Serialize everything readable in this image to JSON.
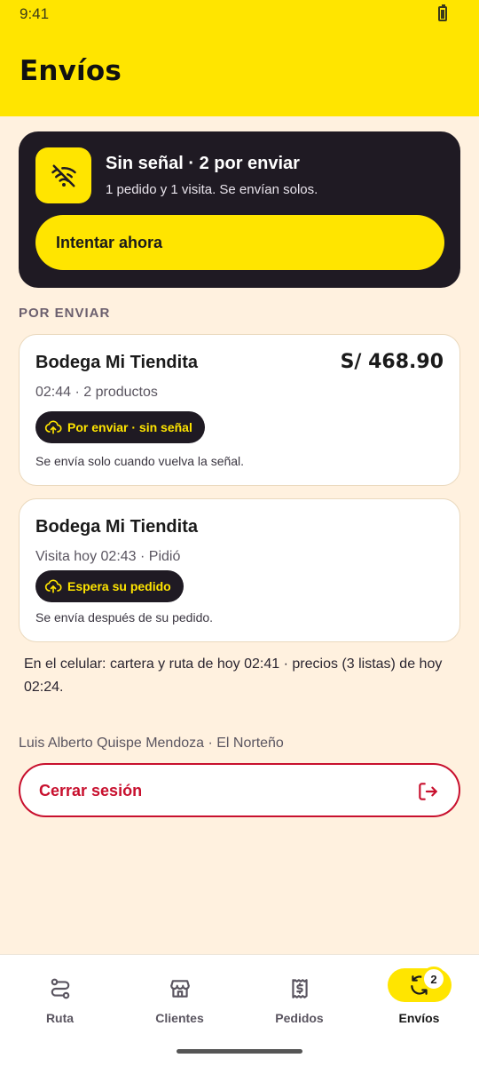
{
  "status_bar": {
    "time": "9:41"
  },
  "header": {
    "title": "Envíos"
  },
  "banner": {
    "icon": "wifi-off-icon",
    "title": "Sin señal · 2 por enviar",
    "subtitle": "1 pedido y 1 visita. Se envían solos.",
    "retry_label": "Intentar ahora"
  },
  "pending": {
    "section_label": "POR ENVIAR",
    "items": [
      {
        "name": "Bodega Mi Tiendita",
        "amount": "S/ 468.90",
        "meta": "02:44 · 2 productos",
        "chip": "Por enviar · sin señal",
        "note": "Se envía solo cuando vuelva la señal."
      },
      {
        "name": "Bodega Mi Tiendita",
        "meta": "Visita hoy 02:43 · Pidió",
        "chip": "Espera su pedido",
        "note": "Se envía después de su pedido."
      }
    ]
  },
  "sync_info": "En el celular: cartera y ruta de hoy 02:41 · precios (3 listas) de hoy 02:24.",
  "user": {
    "line": "Luis Alberto Quispe Mendoza · El Norteño"
  },
  "logout": {
    "label": "Cerrar sesión"
  },
  "nav": {
    "items": [
      {
        "label": "Ruta",
        "icon": "route-icon"
      },
      {
        "label": "Clientes",
        "icon": "store-icon"
      },
      {
        "label": "Pedidos",
        "icon": "receipt-icon"
      },
      {
        "label": "Envíos",
        "icon": "sync-icon",
        "badge": "2",
        "active": true
      }
    ]
  },
  "colors": {
    "brand_yellow": "#FFE500",
    "dark": "#1F1A23",
    "danger": "#C8102E",
    "background": "#FFF1DF"
  }
}
